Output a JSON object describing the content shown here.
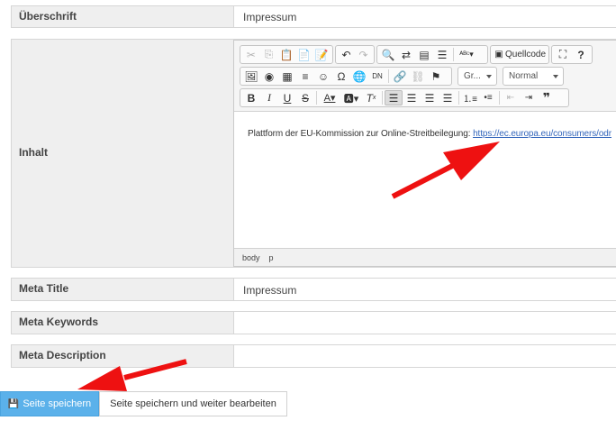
{
  "fields": {
    "ueberschrift": {
      "label": "Überschrift",
      "value": "Impressum"
    },
    "inhalt": {
      "label": "Inhalt"
    },
    "meta_title": {
      "label": "Meta Title",
      "value": "Impressum"
    },
    "meta_keywords": {
      "label": "Meta Keywords",
      "value": ""
    },
    "meta_description": {
      "label": "Meta Description",
      "value": ""
    }
  },
  "editor": {
    "source_label": "Quellcode",
    "format_combo": "Gr...",
    "style_combo": "Normal",
    "content_text": "Plattform der EU-Kommission zur Online-Streitbeilegung: ",
    "content_link": "https://ec.europa.eu/consumers/odr",
    "path": [
      "body",
      "p"
    ]
  },
  "buttons": {
    "save": "Seite speichern",
    "save_continue": "Seite speichern und weiter bearbeiten"
  },
  "colors": {
    "primary": "#5bb1ea",
    "arrow": "#ee1111",
    "link": "#3366bb"
  }
}
